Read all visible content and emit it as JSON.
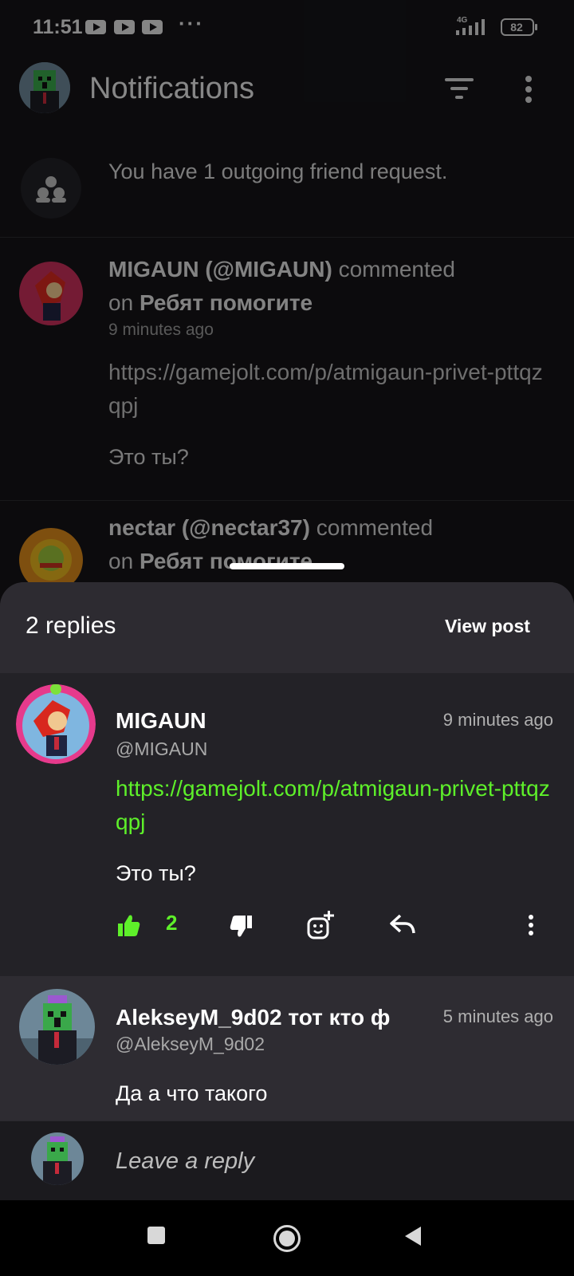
{
  "status_bar": {
    "time": "11:51",
    "more": "···",
    "network": "4G",
    "battery": "82",
    "notification_icons": [
      "youtube-icon",
      "youtube-icon",
      "youtube-icon"
    ]
  },
  "app_bar": {
    "title": "Notifications",
    "icons": [
      "filter-icon",
      "more-vertical-icon"
    ]
  },
  "friend_request": {
    "text": "You have 1 outgoing friend request."
  },
  "notifications": [
    {
      "author": "MIGAUN (@MIGAUN)",
      "action": "commented",
      "on": "on",
      "post_title": "Ребят помогите",
      "time": "9 minutes ago",
      "link": "https://gamejolt.com/p/atmigaun-privet-pttqzqpj",
      "body": "Это ты?"
    },
    {
      "author": "nectar (@nectar37)",
      "action": "commented",
      "on": "on",
      "post_title": "Ребят помогите"
    }
  ],
  "sheet": {
    "title": "2 replies",
    "view_post_label": "View post",
    "comments": [
      {
        "name": "MIGAUN",
        "handle": "@MIGAUN",
        "time": "9 minutes ago",
        "link": "https://gamejolt.com/p/atmigaun-privet-pttqzqpj",
        "body": "Это ты?",
        "likes": "2"
      },
      {
        "name": "AlekseyM_9d02 тот кто ф",
        "handle": "@AlekseyM_9d02",
        "time": "5 minutes ago",
        "body": "Да а что такого"
      }
    ],
    "reply_placeholder": "Leave a reply"
  },
  "colors": {
    "accent": "#5ef02a",
    "sheet_bg": "#232227",
    "sheet_header_bg": "#2d2b31"
  }
}
